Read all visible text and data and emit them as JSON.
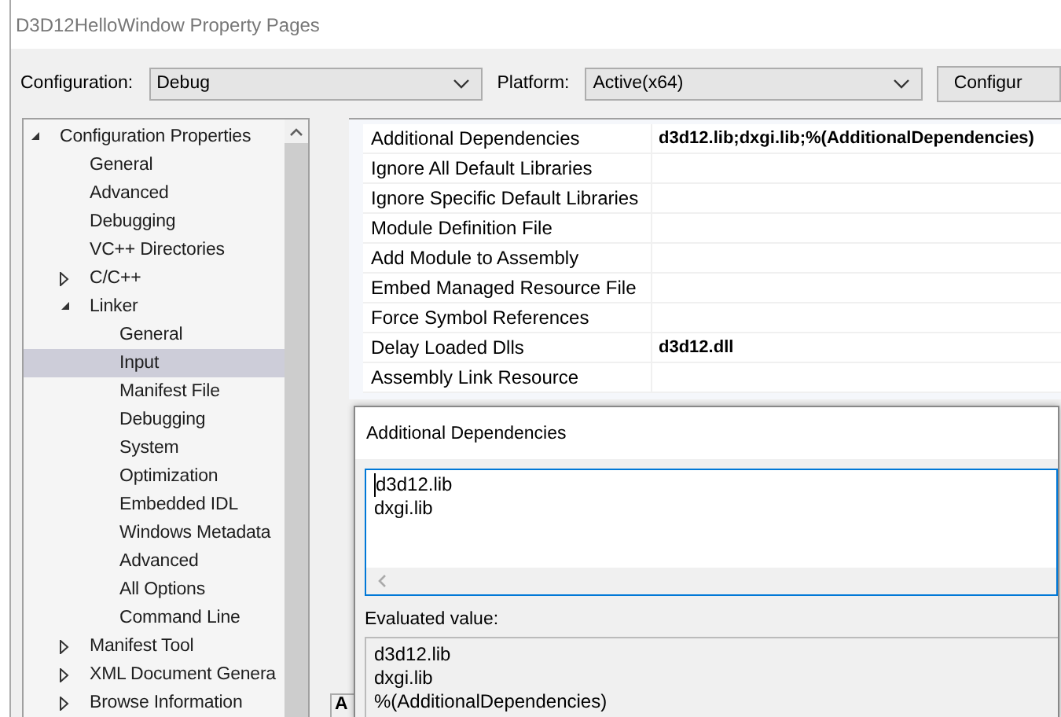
{
  "window": {
    "title": "D3D12HelloWindow Property Pages"
  },
  "toolbar": {
    "configuration_label": "Configuration:",
    "configuration_value": "Debug",
    "platform_label": "Platform:",
    "platform_value": "Active(x64)",
    "config_button": "Configur"
  },
  "tree": [
    {
      "label": "Configuration Properties",
      "expanded": true,
      "selected": false,
      "children": [
        {
          "label": "General",
          "selected": false
        },
        {
          "label": "Advanced",
          "selected": false
        },
        {
          "label": "Debugging",
          "selected": false
        },
        {
          "label": "VC++ Directories",
          "selected": false
        },
        {
          "label": "C/C++",
          "expanded": false,
          "selected": false
        },
        {
          "label": "Linker",
          "expanded": true,
          "selected": false,
          "children": [
            {
              "label": "General",
              "selected": false
            },
            {
              "label": "Input",
              "selected": true
            },
            {
              "label": "Manifest File",
              "selected": false
            },
            {
              "label": "Debugging",
              "selected": false
            },
            {
              "label": "System",
              "selected": false
            },
            {
              "label": "Optimization",
              "selected": false
            },
            {
              "label": "Embedded IDL",
              "selected": false
            },
            {
              "label": "Windows Metadata",
              "selected": false
            },
            {
              "label": "Advanced",
              "selected": false
            },
            {
              "label": "All Options",
              "selected": false
            },
            {
              "label": "Command Line",
              "selected": false
            }
          ]
        },
        {
          "label": "Manifest Tool",
          "expanded": false,
          "selected": false
        },
        {
          "label": "XML Document Genera",
          "expanded": false,
          "selected": false
        },
        {
          "label": "Browse Information",
          "expanded": false,
          "selected": false
        }
      ]
    }
  ],
  "properties": [
    {
      "name": "Additional Dependencies",
      "value": "d3d12.lib;dxgi.lib;%(AdditionalDependencies)",
      "selected": false
    },
    {
      "name": "Ignore All Default Libraries",
      "selected": false
    },
    {
      "name": "Ignore Specific Default Libraries",
      "selected": false
    },
    {
      "name": "Module Definition File",
      "selected": false
    },
    {
      "name": "Add Module to Assembly",
      "selected": false
    },
    {
      "name": "Embed Managed Resource File",
      "selected": false
    },
    {
      "name": "Force Symbol References",
      "selected": false
    },
    {
      "name": "Delay Loaded Dlls",
      "value": "d3d12.dll",
      "selected": false
    },
    {
      "name": "Assembly Link Resource",
      "selected": false
    }
  ],
  "description_tab": "A",
  "dialog": {
    "title": "Additional Dependencies",
    "lines": [
      "d3d12.lib",
      "dxgi.lib"
    ],
    "evaluated_label": "Evaluated value:",
    "evaluated_lines": [
      "d3d12.lib",
      "dxgi.lib",
      "%(AdditionalDependencies)"
    ]
  }
}
